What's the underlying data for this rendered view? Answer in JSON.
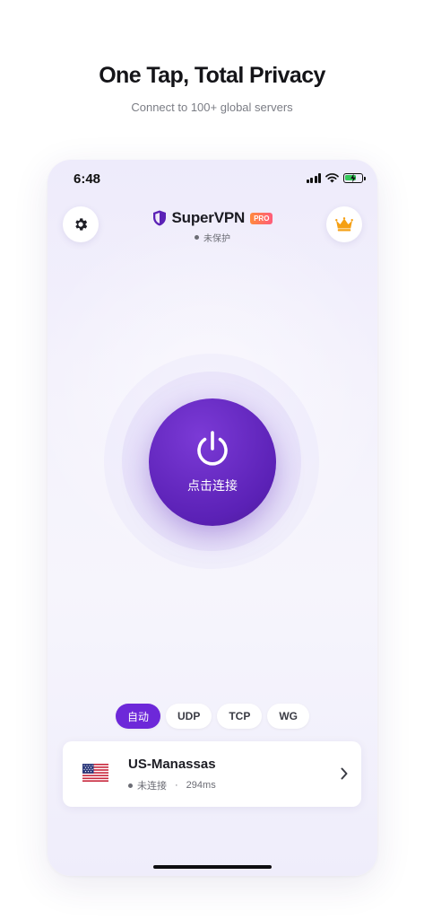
{
  "promo": {
    "headline": "One Tap, Total Privacy",
    "subline": "Connect to 100+ global servers"
  },
  "status_bar": {
    "time": "6:48",
    "icons": [
      "cellular-signal-icon",
      "wifi-icon",
      "battery-charging-icon"
    ],
    "battery_level": 0.7
  },
  "header": {
    "app_name": "SuperVPN",
    "badge": "PRO",
    "connection_status": "未保护",
    "settings_icon": "gear-icon",
    "premium_icon": "crown-icon"
  },
  "power": {
    "label": "点击连接",
    "icon": "power-icon"
  },
  "protocols": {
    "items": [
      "自动",
      "UDP",
      "TCP",
      "WG"
    ],
    "selected": "自动"
  },
  "server": {
    "name": "US-Manassas",
    "flag": "us-flag-icon",
    "status": "未连接",
    "separator": "·",
    "latency": "294ms"
  },
  "colors": {
    "accent": "#6d28d9",
    "power_button": "#5b21b6",
    "pro_badge_start": "#ff8a3d",
    "pro_badge_end": "#ff5c7a",
    "crown": "#f5a014",
    "battery": "#34c759"
  }
}
